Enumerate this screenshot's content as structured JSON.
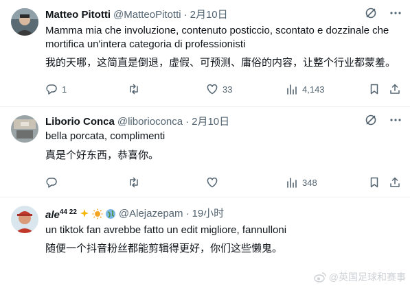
{
  "tweets": [
    {
      "display_name": "Matteo Pitotti",
      "handle": "@MatteoPitotti",
      "separator": "·",
      "time": "2月10日",
      "text_lines": [
        "Mamma mia che involuzione, contenuto posticcio, scontato e dozzinale che",
        "mortifica un'intera categoria di professionisti"
      ],
      "translation": "我的天哪，这简直是倒退，虚假、可预测、庸俗的内容，让整个行业都蒙羞。",
      "replies": "1",
      "retweets": "",
      "likes": "33",
      "views": "4,143"
    },
    {
      "display_name": "Liborio Conca",
      "handle": "@liborioconca",
      "separator": "·",
      "time": "2月10日",
      "text_lines": [
        "bella porcata, complimenti"
      ],
      "translation": "真是个好东西，恭喜你。",
      "replies": "",
      "retweets": "",
      "likes": "",
      "views": "348"
    },
    {
      "display_name": "ale",
      "display_sup": "44 22",
      "handle": "@Alejazepam",
      "separator": "·",
      "time": "19小时",
      "text_lines": [
        "un tiktok fan avrebbe fatto un edit migliore, fannulloni"
      ],
      "translation": "随便一个抖音粉丝都能剪辑得更好，你们这些懒鬼。"
    }
  ],
  "watermark": "@英国足球和赛事",
  "colors": {
    "text": "#0f1419",
    "secondary": "#536471",
    "divider": "#eff3f4"
  },
  "icons": [
    "grok-icon",
    "more-icon",
    "reply-icon",
    "retweet-icon",
    "like-icon",
    "views-icon",
    "bookmark-icon",
    "share-icon"
  ]
}
